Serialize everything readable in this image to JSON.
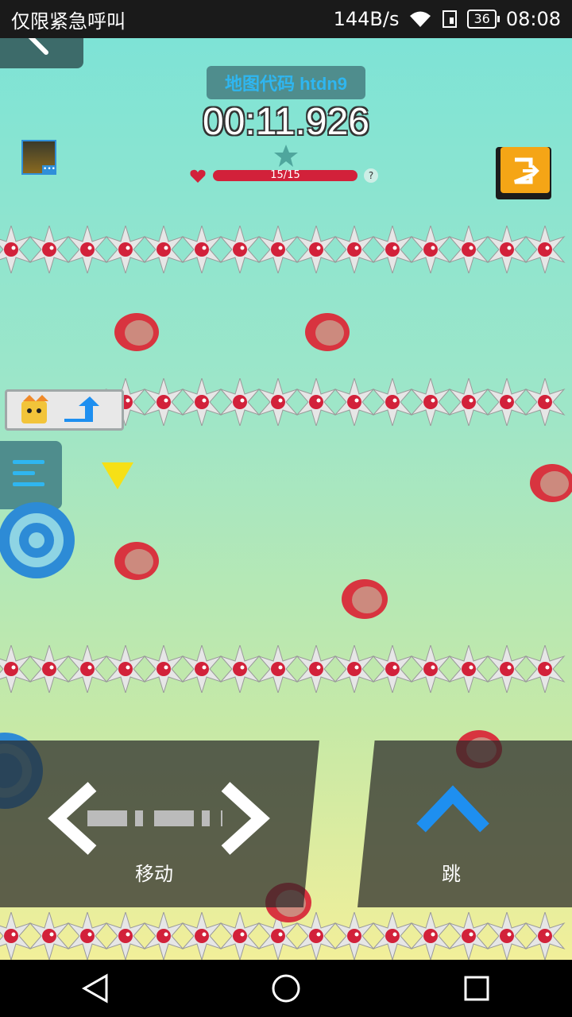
{
  "status_bar": {
    "carrier": "仅限紧急呼叫",
    "speed": "144B/s",
    "battery": "36",
    "time": "08:08"
  },
  "hud": {
    "map_code": "地图代码 htdn9",
    "timer": "00:11.926",
    "hp_text": "15/15",
    "hp_fraction": 1.0,
    "help": "?"
  },
  "controls": {
    "move_label": "移动",
    "jump_label": "跳"
  },
  "colors": {
    "spike_red": "#d2213a",
    "accent_blue": "#1e8ff0",
    "orange_button": "#f5a516"
  }
}
